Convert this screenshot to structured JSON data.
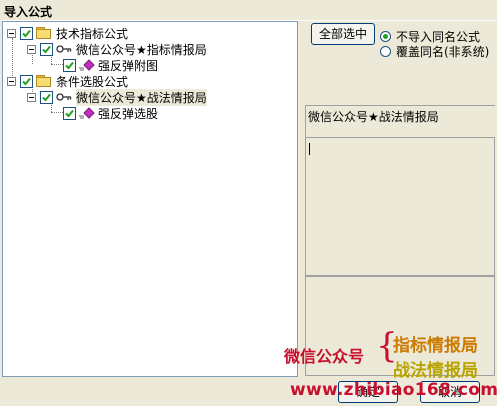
{
  "window": {
    "title": "导入公式"
  },
  "tree": {
    "items": [
      {
        "label": "技术指标公式"
      },
      {
        "label": "微信公众号★指标情报局"
      },
      {
        "label": "强反弹附图"
      },
      {
        "label": "条件选股公式"
      },
      {
        "label": "微信公众号★战法情报局"
      },
      {
        "label": "强反弹选股"
      }
    ]
  },
  "controls": {
    "select_all": "全部选中",
    "radio_no_import": "不导入同名公式",
    "radio_overwrite": "覆盖同名(非系统)",
    "selected_name": "微信公众号★战法情报局",
    "ok": "确定",
    "cancel": "取消"
  },
  "watermark": {
    "left": "微信公众号",
    "right1": "指标情报局",
    "right2": "战法情报局",
    "url": "www.zhibiao168.com"
  },
  "colors": {
    "accent_red": "#c8102e",
    "orange": "#cc7a00",
    "olive": "#b8a400",
    "radio_dot": "#21a121"
  }
}
